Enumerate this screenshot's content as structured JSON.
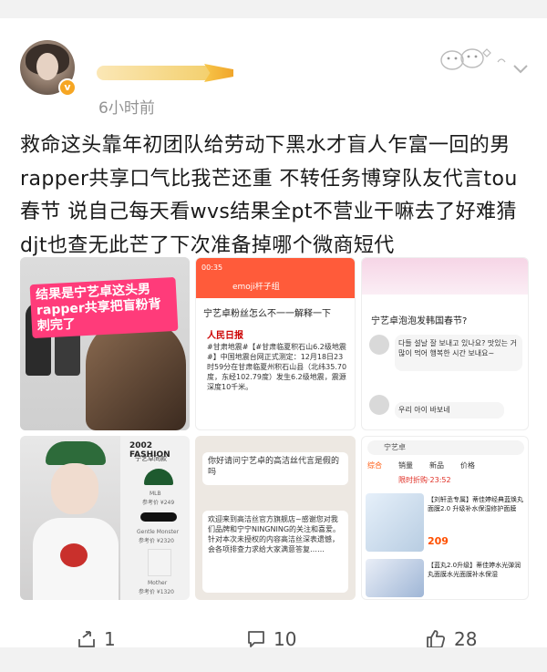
{
  "post": {
    "time": "6小时前",
    "text": "救命这头靠年初团队给劳动下黑水才盲人乍富一回的男rapper共享口气比我芒还重 不转任务博穿队友代言tou春节 说自己每天看wvs结果全pt不营业干嘛去了好难猜 djt也查无此芒了下次准备掉哪个微商短代",
    "verified_badge": "v"
  },
  "images": {
    "img1": {
      "overlay_text": "结果是宁艺卓这头男rapper共享把盲粉背刺完了"
    },
    "img2": {
      "status_time": "00:35",
      "chat_title": "emoji杆子组",
      "headline": "宁艺卓粉丝怎么不一一解释一下",
      "source": "人民日报",
      "news": "#甘肃地震#【#甘肃临夏积石山6.2级地震#】中国地震台网正式测定：12月18日23时59分在甘肃临夏州积石山县（北纬35.70度，东经102.79度）发生6.2级地震，震源深度10千米。",
      "chat_question": "你好请问宁艺卓的高洁丝代言是假的吗",
      "chat_reply": "欢迎来到高洁丝官方旗舰店~感谢您对我们品牌和宁宁NINGNING的关注和喜爱。针对本次未授权的内容高洁丝深表遗憾，会各项排查力求给大家满意答复……"
    },
    "img3": {
      "question": "宁艺卓泡泡发韩国春节?",
      "bubble1": "다들 설날 잘 보내고 있나요? 맛있는 거 많이 먹어 행복한 시간 보내요~",
      "bubble2": "우리 아이 바보네",
      "search": "宁艺卓",
      "tabs": [
        "综合",
        "销量",
        "新品",
        "价格"
      ],
      "promo": "限时折购·23:52",
      "product1": "【刘轩丞专属】蒂佳婷经典蓝焕丸面膜2.0 升级补水保湿修护面膜",
      "price1": "209",
      "product2": "【蓝丸2.0升级】蒂佳婷水光弹润丸面膜水光面膜补水保湿"
    },
    "img4": {
      "magazine": "2002 FASHION",
      "subtitle": "宁艺卓同款",
      "item1": "MLB",
      "item1_price": "参考价 ¥249",
      "item2": "Gentle Monster",
      "item2_price": "参考价 ¥2320",
      "item3": "Mother",
      "item3_price": "参考价 ¥1320"
    }
  },
  "actions": {
    "share_count": "1",
    "comment_count": "10",
    "like_count": "28"
  }
}
